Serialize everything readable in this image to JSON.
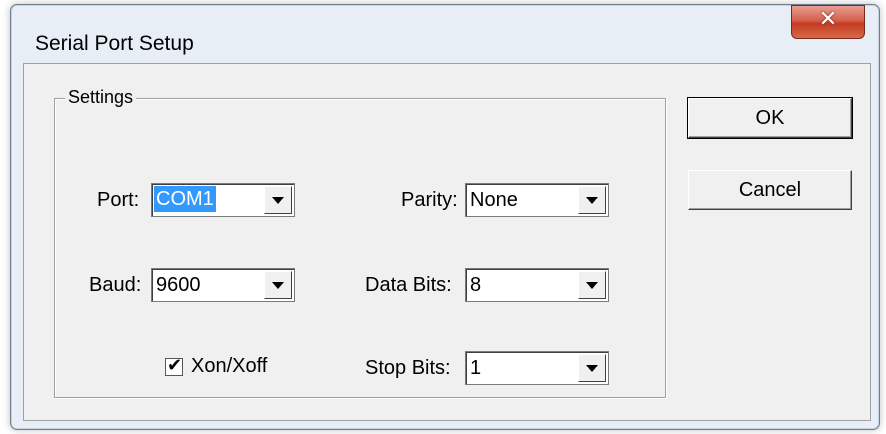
{
  "window": {
    "title": "Serial Port Setup",
    "close_icon": "close-icon"
  },
  "settings": {
    "group_label": "Settings",
    "port": {
      "label": "Port:",
      "value": "COM1"
    },
    "baud": {
      "label": "Baud:",
      "value": "9600"
    },
    "xon_xoff": {
      "label": "Xon/Xoff",
      "checked": true
    },
    "parity": {
      "label": "Parity:",
      "value": "None"
    },
    "data_bits": {
      "label": "Data Bits:",
      "value": "8"
    },
    "stop_bits": {
      "label": "Stop Bits:",
      "value": "1"
    }
  },
  "buttons": {
    "ok_label": "OK",
    "cancel_label": "Cancel"
  },
  "colors": {
    "selection": "#3399ff",
    "close_button": "#c43b22"
  }
}
